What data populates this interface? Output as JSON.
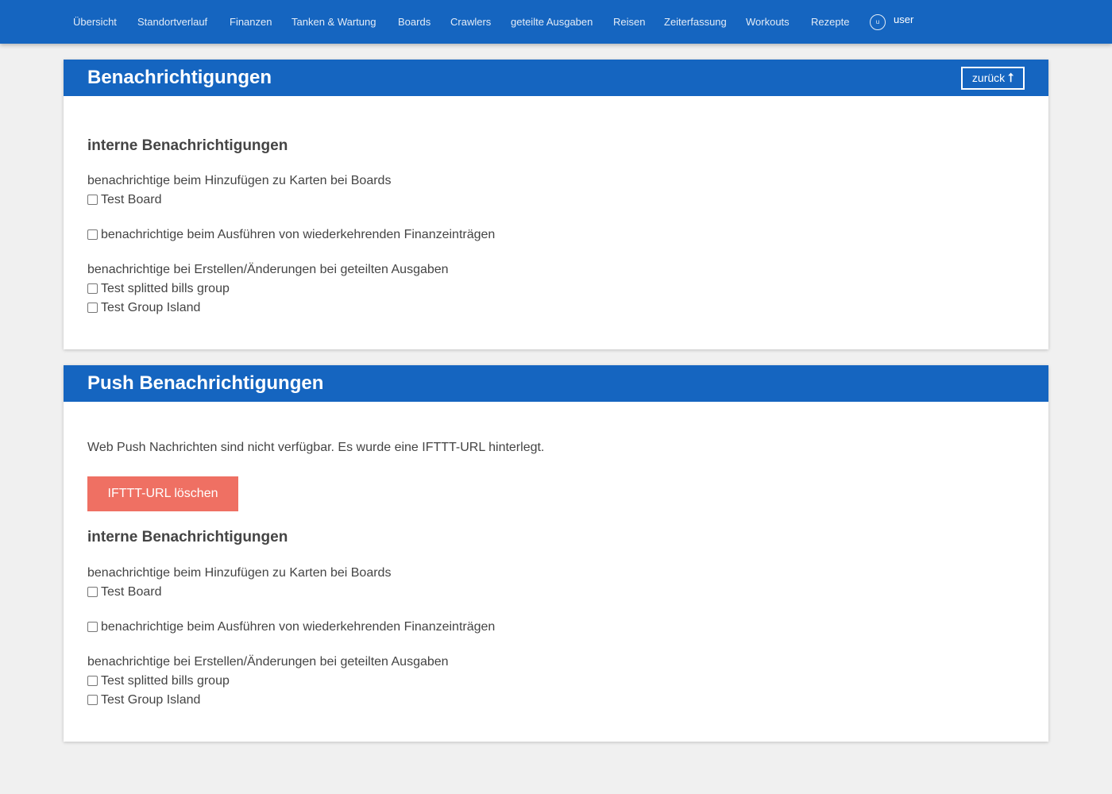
{
  "nav": {
    "items": [
      {
        "label": "Übersicht"
      },
      {
        "label": "Standortverlauf"
      },
      {
        "label": "Finanzen"
      },
      {
        "label": "Tanken & Wartung"
      },
      {
        "label": "Boards"
      },
      {
        "label": "Crawlers"
      },
      {
        "label": "geteilte Ausgaben"
      },
      {
        "label": "Reisen"
      },
      {
        "label": "Zeiterfassung"
      },
      {
        "label": "Workouts"
      },
      {
        "label": "Rezepte"
      }
    ],
    "user_initial": "u",
    "user_name": "user"
  },
  "colors": {
    "primary": "#1565c0",
    "danger_button": "#ef7063",
    "page_background": "#f0f0f0"
  },
  "card1": {
    "title": "Benachrichtigungen",
    "back_label": "zurück",
    "back_icon": "arrow-up-icon",
    "section_title": "interne Benachrichtigungen",
    "boards_label": "benachrichtige beim Hinzufügen zu Karten bei Boards",
    "boards_option": "Test Board",
    "finance_label": "benachrichtige beim Ausführen von wiederkehrenden Finanzeinträgen",
    "splitbills_label": "benachrichtige bei Erstellen/Änderungen bei geteilten Ausgaben",
    "splitbills_option_1": "Test splitted bills group",
    "splitbills_option_2": "Test Group Island"
  },
  "card2": {
    "title": "Push Benachrichtigungen",
    "info_text": "Web Push Nachrichten sind nicht verfügbar. Es wurde eine IFTTT-URL hinterlegt.",
    "delete_button": "IFTTT-URL löschen",
    "section_title": "interne Benachrichtigungen",
    "boards_label": "benachrichtige beim Hinzufügen zu Karten bei Boards",
    "boards_option": "Test Board",
    "finance_label": "benachrichtige beim Ausführen von wiederkehrenden Finanzeinträgen",
    "splitbills_label": "benachrichtige bei Erstellen/Änderungen bei geteilten Ausgaben",
    "splitbills_option_1": "Test splitted bills group",
    "splitbills_option_2": "Test Group Island"
  }
}
